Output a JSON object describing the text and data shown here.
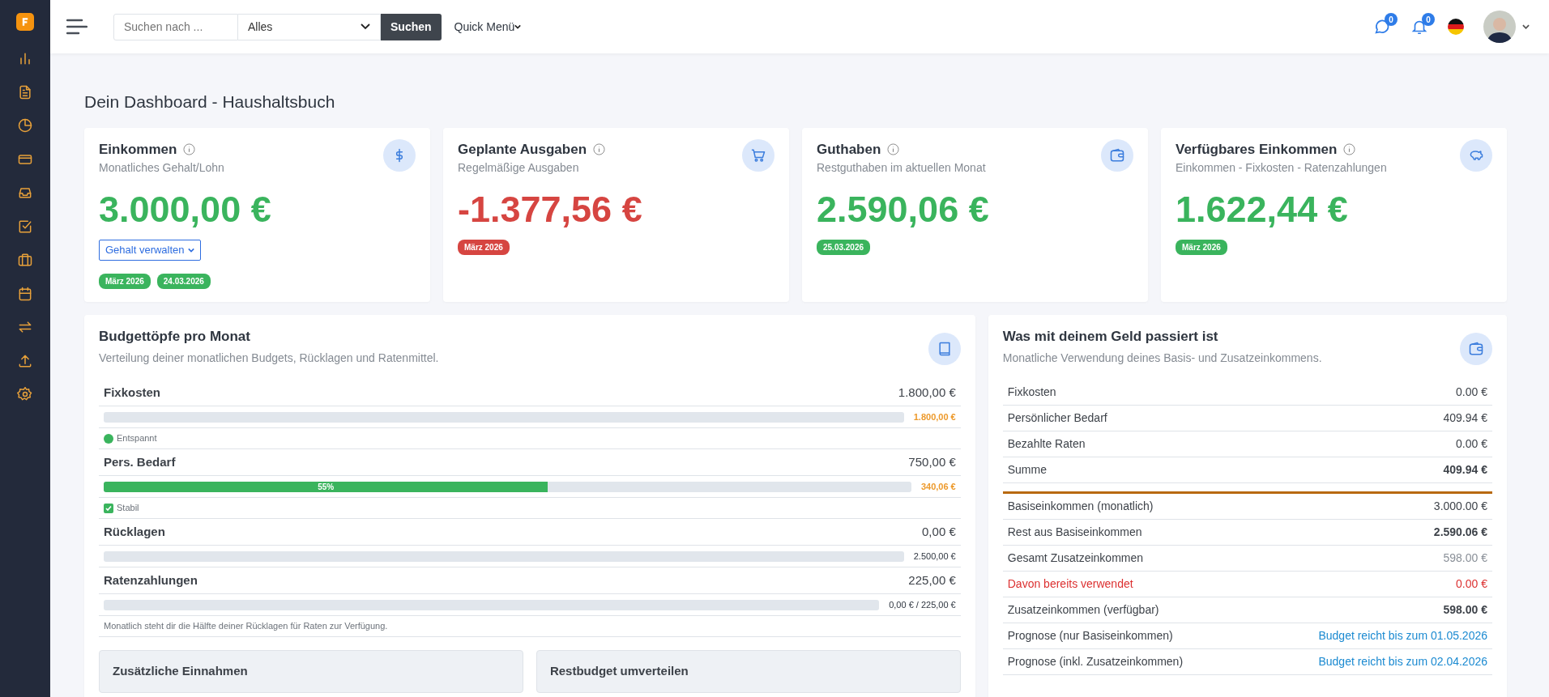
{
  "topbar": {
    "search": {
      "placeholder": "Suchen nach ..."
    },
    "scope": "Alles",
    "search_button": "Suchen",
    "quick_menu": "Quick Menü",
    "messages_count": "0",
    "notifications_count": "0"
  },
  "page_title": "Dein Dashboard - Haushaltsbuch",
  "stat_cards": [
    {
      "title": "Einkommen",
      "subtitle": "Monatliches Gehalt/Lohn",
      "amount": "3.000,00 €",
      "kind": "positive",
      "action": "Gehalt verwalten",
      "badges": [
        "März 2026",
        "24.03.2026"
      ]
    },
    {
      "title": "Geplante Ausgaben",
      "subtitle": "Regelmäßige Ausgaben",
      "amount": "-1.377,56 €",
      "kind": "negative",
      "badges": [
        "März 2026"
      ]
    },
    {
      "title": "Guthaben",
      "subtitle": "Restguthaben im aktuellen Monat",
      "amount": "2.590,06 €",
      "kind": "positive",
      "badges": [
        "25.03.2026"
      ]
    },
    {
      "title": "Verfügbares Einkommen",
      "subtitle": "Einkommen - Fixkosten - Ratenzahlungen",
      "amount": "1.622,44 €",
      "kind": "positive",
      "badges": [
        "März 2026"
      ]
    }
  ],
  "budget_panel": {
    "title": "Budgettöpfe pro Monat",
    "subtitle": "Verteilung deiner monatlichen Budgets, Rücklagen und Ratenmittel.",
    "rows": [
      {
        "label": "Fixkosten",
        "amount": "1.800,00 €",
        "level": 0,
        "reading": "1.800,00 €",
        "warning": true,
        "status": {
          "kind": "dot",
          "text": "Entspannt"
        }
      },
      {
        "label": "Pers. Bedarf",
        "amount": "750,00 €",
        "level": 0.55,
        "bar_label": "55%",
        "reading": "340,06 €",
        "warning": true,
        "status": {
          "kind": "check",
          "text": "Stabil"
        }
      },
      {
        "label": "Rücklagen",
        "amount": "0,00 €",
        "level": 0,
        "reading": "2.500,00 €",
        "warning": false
      },
      {
        "label": "Ratenzahlungen",
        "amount": "225,00 €",
        "level": 0,
        "reading": "0,00 € / 225,00 €",
        "warning": false
      }
    ],
    "note": "Monatlich steht dir die Hälfte deiner Rücklagen für Raten zur Verfügung.",
    "subpanels": [
      "Zusätzliche Einnahmen",
      "Restbudget umverteilen"
    ]
  },
  "money_panel": {
    "title": "Was mit deinem Geld passiert ist",
    "subtitle": "Monatliche Verwendung deines Basis- und Zusatzeinkommens.",
    "spending_rows": [
      {
        "label": "Fixkosten",
        "value": "0.00 €",
        "kind": "plain"
      },
      {
        "label": "Persönlicher Bedarf",
        "value": "409.94 €",
        "kind": "plain"
      },
      {
        "label": "Bezahlte Raten",
        "value": "0.00 €",
        "kind": "plain"
      },
      {
        "label": "Summe",
        "value": "409.94 €",
        "kind": "strong"
      }
    ],
    "income_rows": [
      {
        "label": "Basiseinkommen (monatlich)",
        "value": "3.000.00 €",
        "kind": "plain"
      },
      {
        "label": "Rest aus Basiseinkommen",
        "value": "2.590.06 €",
        "kind": "strong"
      },
      {
        "label": "Gesamt Zusatzeinkommen",
        "value": "598.00 €",
        "kind": "muted"
      },
      {
        "label": "Davon bereits verwendet",
        "value": "0.00 €",
        "kind": "danger"
      },
      {
        "label": "Zusatzeinkommen (verfügbar)",
        "value": "598.00 €",
        "kind": "strong"
      },
      {
        "label": "Prognose (nur Basiseinkommen)",
        "value": "Budget reicht bis zum 01.05.2026",
        "kind": "link"
      },
      {
        "label": "Prognose (inkl. Zusatzeinkommen)",
        "value": "Budget reicht bis zum 02.04.2026",
        "kind": "link"
      }
    ]
  }
}
